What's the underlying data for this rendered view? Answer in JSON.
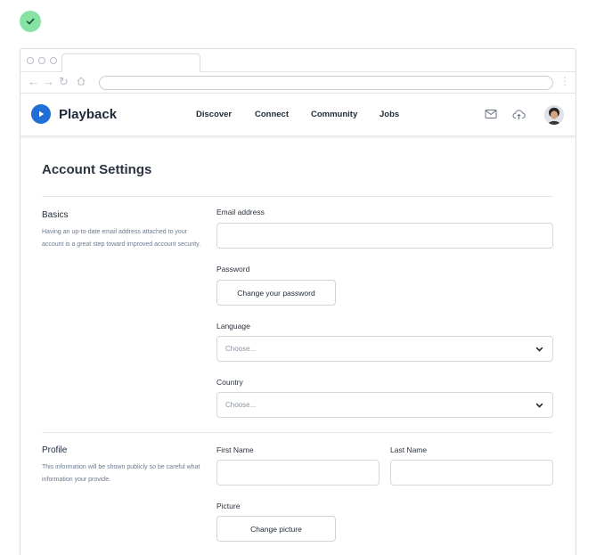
{
  "app": {
    "name": "Playback"
  },
  "nav": {
    "links": [
      "Discover",
      "Connect",
      "Community",
      "Jobs"
    ],
    "icons": [
      "mail-icon",
      "upload-icon"
    ]
  },
  "page": {
    "title": "Account Settings"
  },
  "basics": {
    "title": "Basics",
    "description": "Having an up-to-date email address attached to your account is a great step toward improved account security.",
    "email_label": "Email address",
    "email_value": "",
    "password_label": "Password",
    "password_button": "Change your password",
    "language_label": "Language",
    "language_placeholder": "Choose...",
    "country_label": "Country",
    "country_placeholder": "Choose..."
  },
  "profile": {
    "title": "Profile",
    "description": "This information will be shown publicly so be careful what information your provide.",
    "first_name_label": "First Name",
    "last_name_label": "Last Name",
    "first_name_value": "",
    "last_name_value": "",
    "picture_label": "Picture",
    "picture_button": "Change picture"
  },
  "colors": {
    "brand": "#1f6fd6",
    "success": "#86e3a4"
  }
}
